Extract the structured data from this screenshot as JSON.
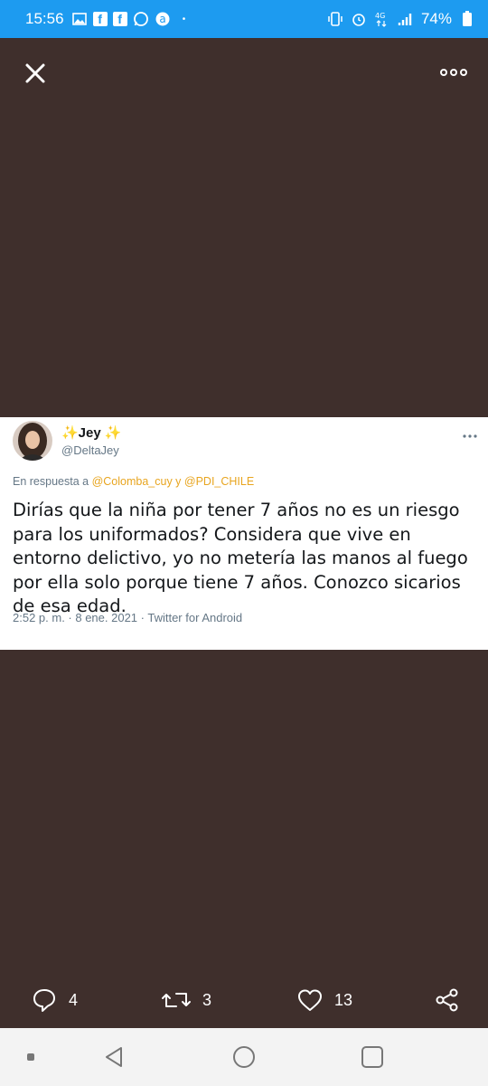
{
  "status_bar": {
    "time": "15:56",
    "battery": "74%",
    "network": "4G",
    "notification_icons": [
      "gallery-icon",
      "facebook-icon",
      "facebook-icon",
      "whatsapp-icon",
      "app-a-icon",
      "dot-icon"
    ],
    "system_icons": [
      "vibrate-icon",
      "alarm-icon",
      "4g-icon",
      "signal-icon",
      "battery-icon"
    ],
    "color": "#1d9bf0"
  },
  "viewer": {
    "background": "#3f2f2c"
  },
  "tweet": {
    "display_name": "✨Jey ✨",
    "handle": "@DeltaJey",
    "reply_prefix": "En respuesta a",
    "reply_mentions": "@Colomba_cuy y @PDI_CHILE",
    "text": "Dirías que la niña por tener 7 años no es un riesgo para los uniformados? Considera que vive en entorno delictivo, yo no metería las manos al fuego por ella solo porque tiene 7 años. Conozco sicarios de esa edad.",
    "meta": "2:52 p. m. · 8 ene. 2021 · Twitter for Android"
  },
  "actions": {
    "reply_count": "4",
    "retweet_count": "3",
    "like_count": "13"
  }
}
